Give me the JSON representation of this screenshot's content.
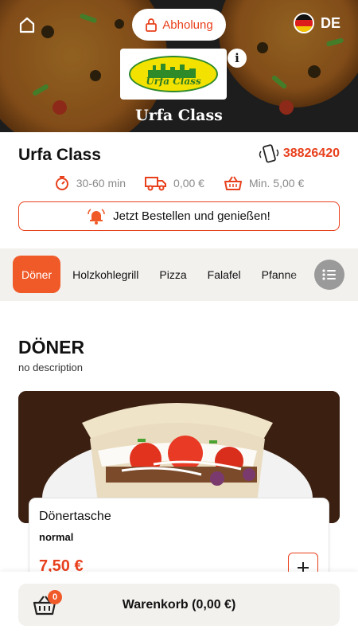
{
  "header": {
    "pickup_label": "Abholung",
    "language": "DE",
    "restaurant_banner": "Urfa Class",
    "logo_text": "Urfa Class"
  },
  "restaurant": {
    "name": "Urfa Class",
    "phone": "38826420",
    "delivery_time": "30-60 min",
    "delivery_fee": "0,00 €",
    "min_order": "Min. 5,00 €",
    "order_cta": "Jetzt Bestellen und genießen!"
  },
  "categories": [
    {
      "label": "Döner",
      "active": true
    },
    {
      "label": "Holzkohlegrill",
      "active": false
    },
    {
      "label": "Pizza",
      "active": false
    },
    {
      "label": "Falafel",
      "active": false
    },
    {
      "label": "Pfanne",
      "active": false
    }
  ],
  "section": {
    "title": "DÖNER",
    "description": "no description"
  },
  "product": {
    "name": "Dönertasche",
    "variant": "normal",
    "price": "7,50 €"
  },
  "cart": {
    "label": "Warenkorb (0,00 €)",
    "count": "0"
  },
  "colors": {
    "accent": "#f05a28",
    "accent_text": "#e8401c",
    "bar_bg": "#f3f1ee"
  },
  "icons": [
    "home-icon",
    "lock-icon",
    "germany-flag-icon",
    "info-icon",
    "phone-icon",
    "timer-icon",
    "delivery-truck-icon",
    "basket-icon",
    "bell-icon",
    "list-icon",
    "plus-icon",
    "cart-icon"
  ]
}
